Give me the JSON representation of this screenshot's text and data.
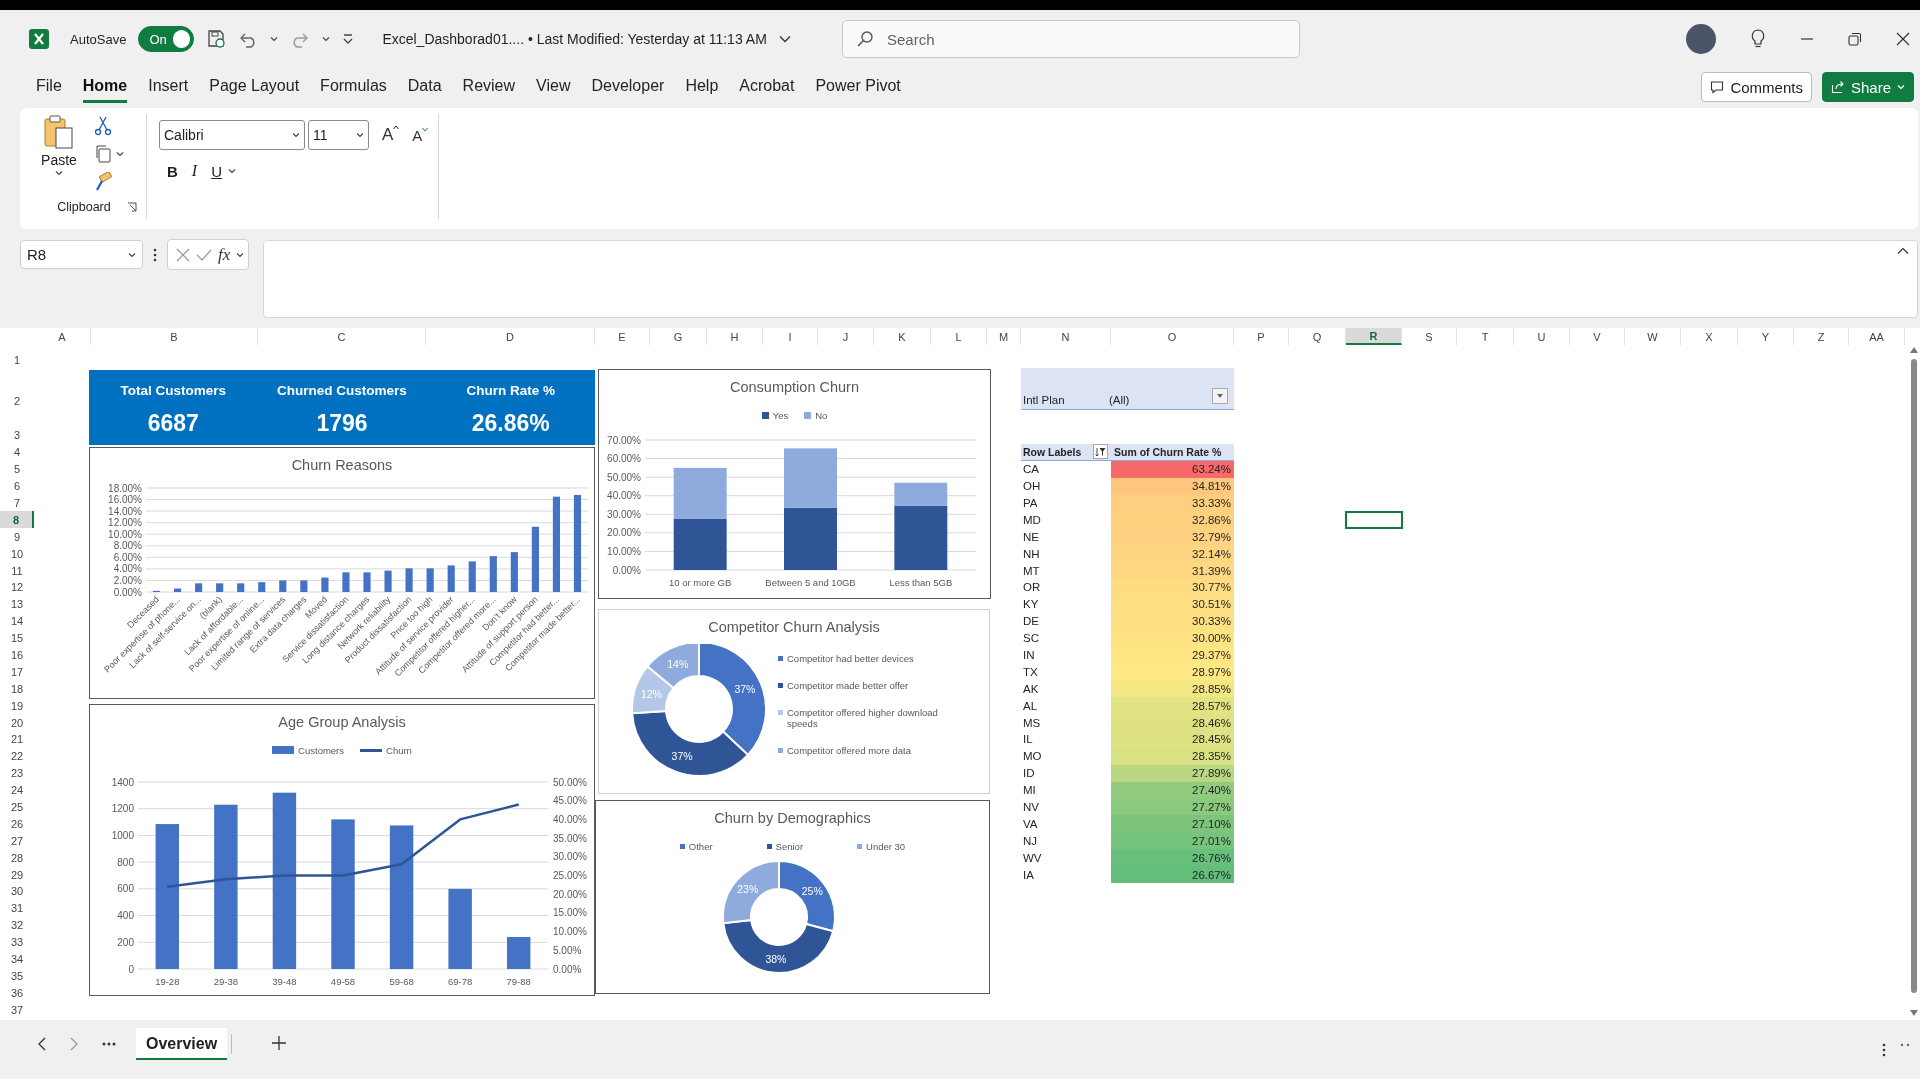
{
  "title_bar": {
    "autosave_label": "AutoSave",
    "autosave": {
      "label": "On",
      "on": true
    },
    "file_title": "Excel_Dashborad01.... • Last Modified: Yesterday at 11:13 AM",
    "search": {
      "placeholder": "Search"
    }
  },
  "menu_tabs": [
    {
      "label": "File",
      "selected": false
    },
    {
      "label": "Home",
      "selected": true
    },
    {
      "label": "Insert",
      "selected": false
    },
    {
      "label": "Page Layout",
      "selected": false
    },
    {
      "label": "Formulas",
      "selected": false
    },
    {
      "label": "Data",
      "selected": false
    },
    {
      "label": "Review",
      "selected": false
    },
    {
      "label": "View",
      "selected": false
    },
    {
      "label": "Developer",
      "selected": false
    },
    {
      "label": "Help",
      "selected": false
    },
    {
      "label": "Acrobat",
      "selected": false
    },
    {
      "label": "Power Pivot",
      "selected": false
    }
  ],
  "actions": [
    {
      "label": "Comments",
      "kind": "outline"
    },
    {
      "label": "Share",
      "kind": "primary"
    }
  ],
  "ribbon": {
    "paste_label": "Paste",
    "group_label": "Clipboard",
    "font": "Calibri",
    "size": "11",
    "grow_font": "A",
    "shrink_font": "A",
    "format_buttons": [
      "B",
      "I",
      "U"
    ]
  },
  "formula_bar": {
    "name_box": "R8",
    "function_label": "fx"
  },
  "columns": [
    {
      "label": "A",
      "selected": false
    },
    {
      "label": "B",
      "selected": false
    },
    {
      "label": "C",
      "selected": false
    },
    {
      "label": "D",
      "selected": false
    },
    {
      "label": "E",
      "selected": false
    },
    {
      "label": "G",
      "selected": false
    },
    {
      "label": "H",
      "selected": false
    },
    {
      "label": "I",
      "selected": false
    },
    {
      "label": "J",
      "selected": false
    },
    {
      "label": "K",
      "selected": false
    },
    {
      "label": "L",
      "selected": false
    },
    {
      "label": "M",
      "selected": false
    },
    {
      "label": "N",
      "selected": false
    },
    {
      "label": "O",
      "selected": false
    },
    {
      "label": "P",
      "selected": false
    },
    {
      "label": "Q",
      "selected": false
    },
    {
      "label": "R",
      "selected": true
    },
    {
      "label": "S",
      "selected": false
    },
    {
      "label": "T",
      "selected": false
    },
    {
      "label": "U",
      "selected": false
    },
    {
      "label": "V",
      "selected": false
    },
    {
      "label": "W",
      "selected": false
    },
    {
      "label": "X",
      "selected": false
    },
    {
      "label": "Y",
      "selected": false
    },
    {
      "label": "Z",
      "selected": false
    },
    {
      "label": "AA",
      "selected": false
    }
  ],
  "rows": [
    {
      "label": "1",
      "selected": false
    },
    {
      "label": "2",
      "selected": false
    },
    {
      "label": "3",
      "selected": false
    },
    {
      "label": "4",
      "selected": false
    },
    {
      "label": "5",
      "selected": false
    },
    {
      "label": "6",
      "selected": false
    },
    {
      "label": "7",
      "selected": false
    },
    {
      "label": "8",
      "selected": true
    },
    {
      "label": "9",
      "selected": false
    },
    {
      "label": "10",
      "selected": false
    },
    {
      "label": "11",
      "selected": false
    },
    {
      "label": "12",
      "selected": false
    },
    {
      "label": "13",
      "selected": false
    },
    {
      "label": "14",
      "selected": false
    },
    {
      "label": "15",
      "selected": false
    },
    {
      "label": "16",
      "selected": false
    },
    {
      "label": "17",
      "selected": false
    },
    {
      "label": "18",
      "selected": false
    },
    {
      "label": "19",
      "selected": false
    },
    {
      "label": "20",
      "selected": false
    },
    {
      "label": "21",
      "selected": false
    },
    {
      "label": "22",
      "selected": false
    },
    {
      "label": "23",
      "selected": false
    },
    {
      "label": "24",
      "selected": false
    },
    {
      "label": "25",
      "selected": false
    },
    {
      "label": "26",
      "selected": false
    },
    {
      "label": "27",
      "selected": false
    },
    {
      "label": "28",
      "selected": false
    },
    {
      "label": "29",
      "selected": false
    },
    {
      "label": "30",
      "selected": false
    },
    {
      "label": "31",
      "selected": false
    },
    {
      "label": "32",
      "selected": false
    },
    {
      "label": "33",
      "selected": false
    },
    {
      "label": "34",
      "selected": false
    },
    {
      "label": "35",
      "selected": false
    },
    {
      "label": "36",
      "selected": false
    },
    {
      "label": "37",
      "selected": false
    }
  ],
  "kpis": [
    {
      "label": "Total Customers",
      "value": "6687"
    },
    {
      "label": "Churned Customers",
      "value": "1796"
    },
    {
      "label": "Churn Rate %",
      "value": "26.86%"
    }
  ],
  "charts": [
    {
      "chart_data": {
        "type": "bar",
        "title": "Churn Reasons",
        "categories": [
          "Deceased",
          "Poor expertise of phone...",
          "Lack of self-service on...",
          "(blank)",
          "Lack of affordable...",
          "Poor expertise of online...",
          "Limited range of services",
          "Extra data charges",
          "Moved",
          "Service dissatisfaction",
          "Long distance charges",
          "Network reliability",
          "Product dissatisfaction",
          "Price too high",
          "Attitude of service provider",
          "Competitor offered higher...",
          "Competitor offered more...",
          "Don't know",
          "Attitude of support person",
          "Competitor had better...",
          "Competitor made better..."
        ],
        "values": [
          0.2,
          0.6,
          1.5,
          1.5,
          1.5,
          1.7,
          2.0,
          2.0,
          2.5,
          3.4,
          3.4,
          3.7,
          4.1,
          4.1,
          4.6,
          5.3,
          6.2,
          6.9,
          11.3,
          16.5,
          16.8
        ],
        "grid": true,
        "ylim": [
          0,
          18
        ],
        "yticks": [
          {
            "value": 0,
            "label": "0.00%"
          },
          {
            "value": 2,
            "label": "2.00%"
          },
          {
            "value": 4,
            "label": "4.00%"
          },
          {
            "value": 6,
            "label": "6.00%"
          },
          {
            "value": 8,
            "label": "8.00%"
          },
          {
            "value": 10,
            "label": "10.00%"
          },
          {
            "value": 12,
            "label": "12.00%"
          },
          {
            "value": 14,
            "label": "14.00%"
          },
          {
            "value": 16,
            "label": "16.00%"
          },
          {
            "value": 18,
            "label": "18.00%"
          }
        ]
      }
    },
    {
      "chart_data": {
        "type": "bar",
        "title": "Age Group Analysis",
        "categories": [
          "19-28",
          "29-38",
          "39-48",
          "49-58",
          "59-68",
          "69-78",
          "79-88"
        ],
        "series": [
          {
            "name": "Customers",
            "color": "#4472c4",
            "values": [
              1085,
              1230,
              1320,
              1120,
              1075,
              600,
              240
            ]
          },
          {
            "name": "Churn",
            "color": "#2f5597",
            "type": "line",
            "axis": "y2",
            "values": [
              22,
              24,
              25,
              25,
              28,
              40,
              44
            ]
          }
        ],
        "grid": true,
        "legend": "top",
        "ylim": [
          0,
          1400
        ],
        "yticks": [
          {
            "value": 0,
            "label": "0"
          },
          {
            "value": 200,
            "label": "200"
          },
          {
            "value": 400,
            "label": "400"
          },
          {
            "value": 600,
            "label": "600"
          },
          {
            "value": 800,
            "label": "800"
          },
          {
            "value": 1000,
            "label": "1000"
          },
          {
            "value": 1200,
            "label": "1200"
          },
          {
            "value": 1400,
            "label": "1400"
          }
        ],
        "y2lim": [
          0,
          50
        ],
        "y2ticks": [
          {
            "value": 0,
            "label": "0.00%"
          },
          {
            "value": 5,
            "label": "5.00%"
          },
          {
            "value": 10,
            "label": "10.00%"
          },
          {
            "value": 15,
            "label": "15.00%"
          },
          {
            "value": 20,
            "label": "20.00%"
          },
          {
            "value": 25,
            "label": "25.00%"
          },
          {
            "value": 30,
            "label": "30.00%"
          },
          {
            "value": 35,
            "label": "35.00%"
          },
          {
            "value": 40,
            "label": "40.00%"
          },
          {
            "value": 45,
            "label": "45.00%"
          },
          {
            "value": 50,
            "label": "50.00%"
          }
        ]
      }
    },
    {
      "chart_data": {
        "type": "bar",
        "title": "Consumption Churn",
        "stacked": true,
        "categories": [
          "10 or more GB",
          "Between 5 and 10GB",
          "Less than 5GB"
        ],
        "series": [
          {
            "name": "Yes",
            "color": "#2f5597",
            "values": [
              27.5,
              33.5,
              34.5
            ]
          },
          {
            "name": "No",
            "color": "#8faadc",
            "values": [
              27.5,
              32.0,
              12.5
            ]
          }
        ],
        "grid": true,
        "legend": "top",
        "ylim": [
          0,
          70
        ],
        "yticks": [
          {
            "value": 0,
            "label": "0.00%"
          },
          {
            "value": 10,
            "label": "10.00%"
          },
          {
            "value": 20,
            "label": "20.00%"
          },
          {
            "value": 30,
            "label": "30.00%"
          },
          {
            "value": 40,
            "label": "40.00%"
          },
          {
            "value": 50,
            "label": "50.00%"
          },
          {
            "value": 60,
            "label": "60.00%"
          },
          {
            "value": 70,
            "label": "70.00%"
          }
        ]
      }
    },
    {
      "chart_data": {
        "type": "donut",
        "title": "Competitor Churn Analysis",
        "legend": "right",
        "categories": [
          "Competitor had better devices",
          "Competitor made better offer",
          "Competitor offered higher download speeds",
          "Competitor offered more data"
        ],
        "values": [
          37,
          37,
          12,
          14
        ],
        "colors": [
          "#4472c4",
          "#2f5597",
          "#b4c7e7",
          "#8faadc"
        ],
        "value_labels": [
          "37%",
          "37%",
          "12%",
          "14%"
        ]
      }
    },
    {
      "chart_data": {
        "type": "donut",
        "title": "Churn by Demographics",
        "legend": "top",
        "categories": [
          "Other",
          "Senior",
          "Under 30"
        ],
        "values": [
          25,
          38,
          23
        ],
        "colors": [
          "#4472c4",
          "#2f5597",
          "#8faadc"
        ],
        "value_labels": [
          "25%",
          "38%",
          "23%"
        ]
      }
    }
  ],
  "pivot": {
    "filter": {
      "label": "Intl Plan",
      "value": "(All)"
    },
    "header": {
      "row_labels": "Row Labels",
      "value_column": "Sum of Churn Rate %"
    },
    "rows": [
      {
        "label": "CA",
        "value": "63.24%",
        "color": "#f8696b"
      },
      {
        "label": "OH",
        "value": "34.81%",
        "color": "#fdc77d"
      },
      {
        "label": "PA",
        "value": "33.33%",
        "color": "#fdcf7f"
      },
      {
        "label": "MD",
        "value": "32.86%",
        "color": "#fed17f"
      },
      {
        "label": "NE",
        "value": "32.79%",
        "color": "#fed280"
      },
      {
        "label": "NH",
        "value": "32.14%",
        "color": "#fed580"
      },
      {
        "label": "MT",
        "value": "31.39%",
        "color": "#fed981"
      },
      {
        "label": "OR",
        "value": "30.77%",
        "color": "#fedc81"
      },
      {
        "label": "KY",
        "value": "30.51%",
        "color": "#fede82"
      },
      {
        "label": "DE",
        "value": "30.33%",
        "color": "#fee082"
      },
      {
        "label": "SC",
        "value": "30.00%",
        "color": "#fee382"
      },
      {
        "label": "IN",
        "value": "29.37%",
        "color": "#fee683"
      },
      {
        "label": "TX",
        "value": "28.97%",
        "color": "#fee883"
      },
      {
        "label": "AK",
        "value": "28.85%",
        "color": "#f3e683"
      },
      {
        "label": "AL",
        "value": "28.57%",
        "color": "#e2e383"
      },
      {
        "label": "MS",
        "value": "28.46%",
        "color": "#dfe283"
      },
      {
        "label": "IL",
        "value": "28.45%",
        "color": "#dde283"
      },
      {
        "label": "MO",
        "value": "28.35%",
        "color": "#dae182"
      },
      {
        "label": "ID",
        "value": "27.89%",
        "color": "#b9d780"
      },
      {
        "label": "MI",
        "value": "27.40%",
        "color": "#90cb7e"
      },
      {
        "label": "NV",
        "value": "27.27%",
        "color": "#8ac97e"
      },
      {
        "label": "VA",
        "value": "27.10%",
        "color": "#7dc57c"
      },
      {
        "label": "NJ",
        "value": "27.01%",
        "color": "#77c47c"
      },
      {
        "label": "WV",
        "value": "26.76%",
        "color": "#67bf7b"
      },
      {
        "label": "IA",
        "value": "26.67%",
        "color": "#63be7b"
      }
    ]
  },
  "sheet_tabs": [
    {
      "label": "Overview",
      "selected": true
    }
  ]
}
